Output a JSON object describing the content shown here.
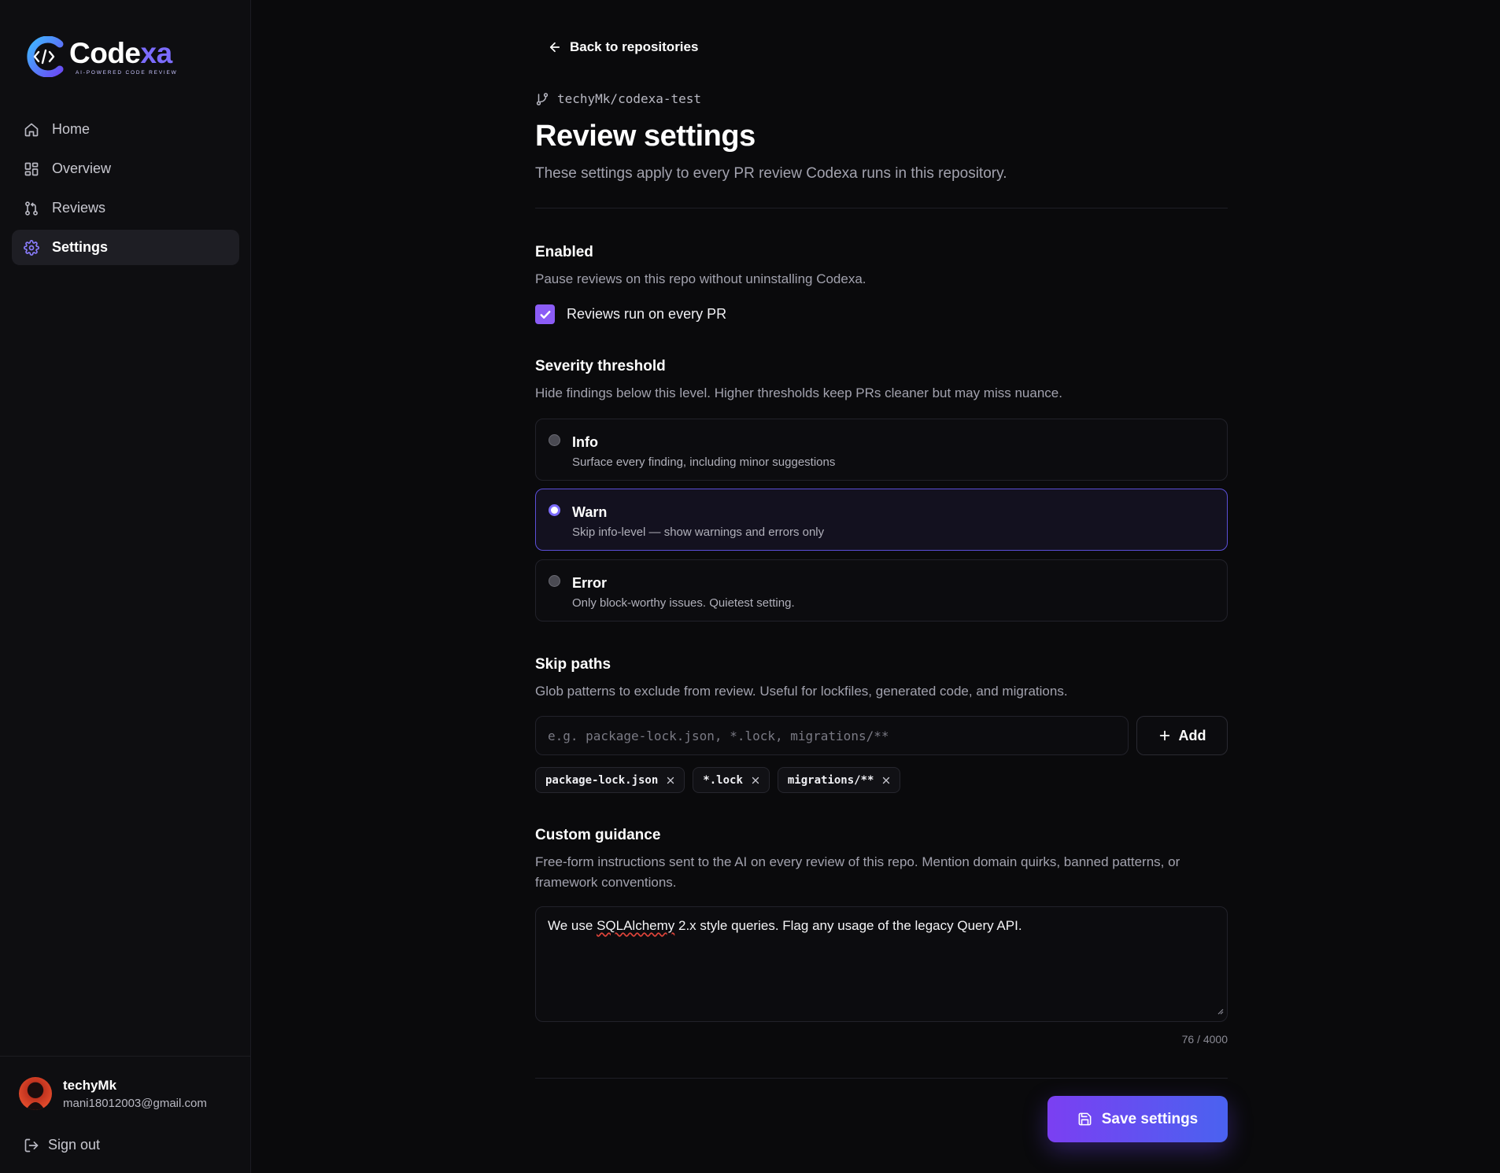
{
  "brand": {
    "name_main": "Code",
    "name_accent": "xa",
    "tagline": "AI-POWERED CODE REVIEW"
  },
  "sidebar": {
    "items": [
      {
        "label": "Home",
        "icon": "home-icon"
      },
      {
        "label": "Overview",
        "icon": "grid-icon"
      },
      {
        "label": "Reviews",
        "icon": "git-pull-request-icon"
      },
      {
        "label": "Settings",
        "icon": "gear-icon",
        "active": true
      }
    ]
  },
  "user": {
    "name": "techyMk",
    "email": "mani18012003@gmail.com",
    "signout_label": "Sign out"
  },
  "header": {
    "back_label": "Back to repositories",
    "repo": "techyMk/codexa-test",
    "title": "Review settings",
    "subtitle": "These settings apply to every PR review Codexa runs in this repository."
  },
  "enabled": {
    "title": "Enabled",
    "description": "Pause reviews on this repo without uninstalling Codexa.",
    "checkbox_label": "Reviews run on every PR",
    "checked": true
  },
  "severity": {
    "title": "Severity threshold",
    "description": "Hide findings below this level. Higher thresholds keep PRs cleaner but may miss nuance.",
    "options": [
      {
        "title": "Info",
        "description": "Surface every finding, including minor suggestions",
        "selected": false
      },
      {
        "title": "Warn",
        "description": "Skip info-level — show warnings and errors only",
        "selected": true
      },
      {
        "title": "Error",
        "description": "Only block-worthy issues. Quietest setting.",
        "selected": false
      }
    ]
  },
  "skip_paths": {
    "title": "Skip paths",
    "description": "Glob patterns to exclude from review. Useful for lockfiles, generated code, and migrations.",
    "input_placeholder": "e.g. package-lock.json, *.lock, migrations/**",
    "input_value": "",
    "add_label": "Add",
    "chips": [
      "package-lock.json",
      "*.lock",
      "migrations/**"
    ]
  },
  "guidance": {
    "title": "Custom guidance",
    "description": "Free-form instructions sent to the AI on every review of this repo. Mention domain quirks, banned patterns, or framework conventions.",
    "text_before": "We use ",
    "text_misspelled": "SQLAlchemy",
    "text_after": " 2.x style queries. Flag any usage of the legacy Query API.",
    "char_count": "76 / 4000"
  },
  "save_label": "Save settings",
  "colors": {
    "accent": "#7c6cff",
    "checkbox": "#8b5cf6",
    "save_gradient_start": "#7b3ff2",
    "save_gradient_end": "#4a62f0"
  }
}
